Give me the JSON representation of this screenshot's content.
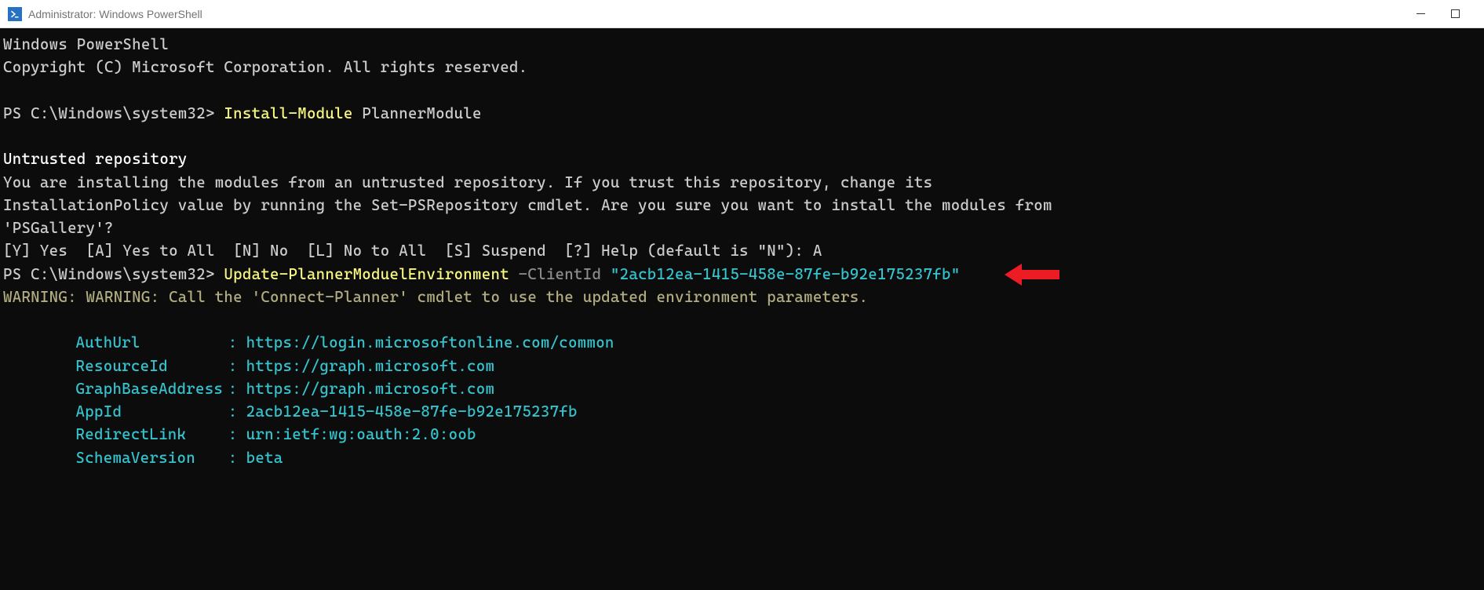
{
  "window": {
    "title": "Administrator: Windows PowerShell"
  },
  "terminal": {
    "header_line1": "Windows PowerShell",
    "header_line2": "Copyright (C) Microsoft Corporation. All rights reserved.",
    "prompt1": "PS C:\\Windows\\system32> ",
    "cmd1_cmdlet": "Install-Module",
    "cmd1_arg": " PlannerModule",
    "untrusted_title": "Untrusted repository",
    "untrusted_body1": "You are installing the modules from an untrusted repository. If you trust this repository, change its",
    "untrusted_body2": "InstallationPolicy value by running the Set-PSRepository cmdlet. Are you sure you want to install the modules from",
    "untrusted_body3": "'PSGallery'?",
    "options_line": "[Y] Yes  [A] Yes to All  [N] No  [L] No to All  [S] Suspend  [?] Help (default is \"N\"): A",
    "prompt2": "PS C:\\Windows\\system32> ",
    "cmd2_cmdlet": "Update-PlannerModuelEnvironment",
    "cmd2_param": " -ClientId ",
    "cmd2_value": "\"2acb12ea-1415-458e-87fe-b92e175237fb\"",
    "warning": "WARNING: WARNING: Call the 'Connect-Planner' cmdlet to use the updated environment parameters.",
    "props": [
      {
        "name": "AuthUrl",
        "value": "https://login.microsoftonline.com/common"
      },
      {
        "name": "ResourceId",
        "value": "https://graph.microsoft.com"
      },
      {
        "name": "GraphBaseAddress",
        "value": "https://graph.microsoft.com"
      },
      {
        "name": "AppId",
        "value": "2acb12ea-1415-458e-87fe-b92e175237fb"
      },
      {
        "name": "RedirectLink",
        "value": "urn:ietf:wg:oauth:2.0:oob"
      },
      {
        "name": "SchemaVersion",
        "value": "beta"
      }
    ]
  }
}
